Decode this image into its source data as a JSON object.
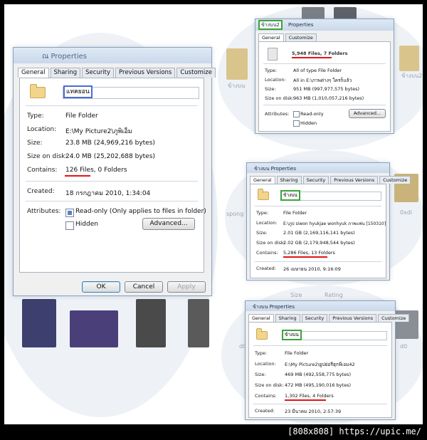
{
  "backdrop": {
    "ghost_labels": [
      "ข้างบน",
      "ข้างบน2",
      "spong",
      "0xdi",
      "Size",
      "Rating",
      "d0",
      "d0"
    ]
  },
  "window_main": {
    "title": "ณ Properties",
    "tabs": [
      "General",
      "Sharing",
      "Security",
      "Previous Versions",
      "Customize"
    ],
    "folder_name": "แทคยอน",
    "type_label": "Type:",
    "type_value": "File Folder",
    "location_label": "Location:",
    "location_value": "E:\\My Picture2\\ภูพิเอ็ม",
    "size_label": "Size:",
    "size_value": "23.8 MB (24,969,216 bytes)",
    "size_on_disk_label": "Size on disk:",
    "size_on_disk_value": "24.0 MB (25,202,688 bytes)",
    "contains_label": "Contains:",
    "contains_files": "126 Files",
    "contains_rest": ", 0 Folders",
    "created_label": "Created:",
    "created_value": "18 กรกฎาคม 2010, 1:34:04",
    "attributes_label": "Attributes:",
    "readonly_label": "Read-only (Only applies to files in folder)",
    "hidden_label": "Hidden",
    "advanced_button": "Advanced...",
    "ok_button": "OK",
    "cancel_button": "Cancel",
    "apply_button": "Apply"
  },
  "window_top_right": {
    "title_highlight": "ข้างบน2",
    "title_rest": "Properties",
    "tabs": [
      "General",
      "Customize"
    ],
    "files_summary": "5,948 Files, 7 Folders",
    "type_label": "Type:",
    "type_value": "All of type File Folder",
    "location_label": "Location:",
    "location_value": "All in E:\\ภาพต่างๆ ใครก็แล้ว",
    "size_label": "Size:",
    "size_value": "951 MB (997,977,575 bytes)",
    "size_on_disk_label": "Size on disk:",
    "size_on_disk_value": "963 MB (1,010,057,216 bytes)",
    "attributes_label": "Attributes:",
    "readonly_label": "Read-only",
    "hidden_label": "Hidden",
    "advanced_button": "Advanced..."
  },
  "window_mid_right": {
    "title": "ข้างบน Properties",
    "tabs": [
      "General",
      "Sharing",
      "Security",
      "Previous Versions",
      "Customize"
    ],
    "folder_name": "ข้างบน",
    "type_label": "Type:",
    "type_value": "File Folder",
    "location_label": "Location:",
    "location_value": "E:\\ภูป siwon hyukjae wonhyuk ภาพแฟน [150310]",
    "size_label": "Size:",
    "size_value": "2.01 GB (2,169,116,141 bytes)",
    "size_on_disk_label": "Size on disk:",
    "size_on_disk_value": "2.02 GB (2,179,948,544 bytes)",
    "contains_label": "Contains:",
    "contains_value": "5,286 Files, 13 Folders",
    "created_label": "Created:",
    "created_value": "26 เมษายน 2010, 9:16:09"
  },
  "window_bottom_right": {
    "title": "ข้างบน Properties",
    "tabs": [
      "General",
      "Sharing",
      "Security",
      "Previous Versions",
      "Customize"
    ],
    "folder_name": "ข้างบน",
    "type_label": "Type:",
    "type_value": "File Folder",
    "location_label": "Location:",
    "location_value": "E:\\My Picture2\\ยูปย่อรีฮุกพีเอม42",
    "size_label": "Size:",
    "size_value": "469 MB (492,558,775 bytes)",
    "size_on_disk_label": "Size on disk:",
    "size_on_disk_value": "472 MB (495,190,016 bytes)",
    "contains_label": "Contains:",
    "contains_value": "1,302 Files, 4 Folders",
    "created_label": "Created:",
    "created_value": "23 มีนาคม 2010, 2:57:39"
  },
  "watermark": "[808x808] https://upic.me/",
  "colors": {
    "highlight_blue": "#4c6bd6",
    "highlight_green": "#3aa33a",
    "underline_red": "#e01515",
    "footer_bg": "#000000"
  }
}
